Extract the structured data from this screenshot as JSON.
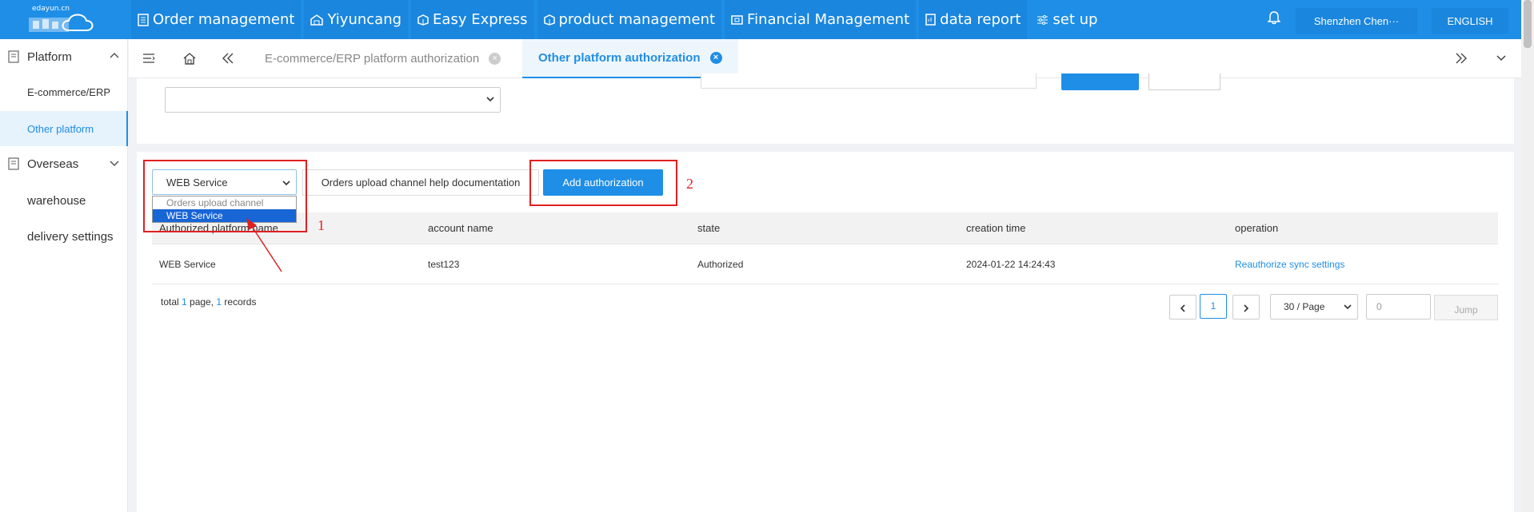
{
  "logo": {
    "text": "edayun.cn"
  },
  "nav": {
    "items": [
      {
        "label": "Order management",
        "icon": "document-icon"
      },
      {
        "label": "Yiyuncang",
        "icon": "warehouse-icon"
      },
      {
        "label": "Easy Express",
        "icon": "box-icon"
      },
      {
        "label": "product management",
        "icon": "box-icon"
      },
      {
        "label": "Financial Management",
        "icon": "wallet-icon"
      },
      {
        "label": "data report",
        "icon": "report-icon"
      },
      {
        "label": "set up",
        "icon": "sliders-icon"
      }
    ],
    "user": "Shenzhen Chen···",
    "language": "ENGLISH"
  },
  "sidebar": {
    "platform_group": "Platform",
    "items": [
      "E-commerce/ERP",
      "Other platform"
    ],
    "overseas_group": "Overseas",
    "warehouse": "warehouse",
    "delivery": "delivery settings"
  },
  "tabs": {
    "inactive": "E-commerce/ERP platform authorization",
    "active": "Other platform authorization",
    "close_glyph": "×"
  },
  "toolbar": {
    "channel_value": "WEB Service",
    "dropdown_options": [
      "Orders upload channel",
      "WEB Service"
    ],
    "help_doc": "Orders upload channel help documentation",
    "add_authorization": "Add authorization"
  },
  "annotations": {
    "marker1": "1",
    "marker2": "2",
    "color": "#e02020"
  },
  "table": {
    "headers": [
      "Authorized platform name",
      "account name",
      "state",
      "creation time",
      "operation"
    ],
    "rows": [
      [
        "WEB Service",
        "test123",
        "Authorized",
        "2024-01-22 14:24:43",
        "Reauthorize sync settings"
      ]
    ]
  },
  "pagination": {
    "total_prefix": "total ",
    "total_pages": "1",
    "total_mid": " page, ",
    "total_records": "1",
    "total_suffix": " records",
    "current_page": "1",
    "page_size": "30 / Page",
    "jump_input": "0",
    "jump_label": "Jump"
  },
  "colors": {
    "primary": "#1e8ee6",
    "nav_bg": "#1e8ee6"
  }
}
